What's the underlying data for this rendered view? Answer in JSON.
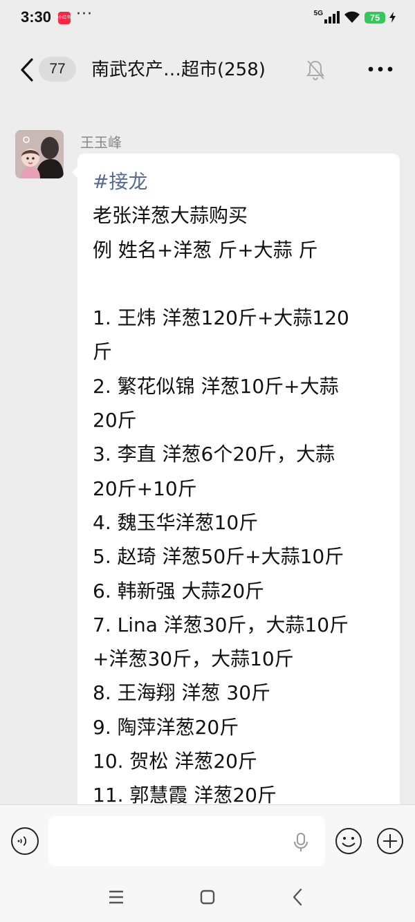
{
  "status_bar": {
    "time": "3:30",
    "app_badge": "小红书",
    "more": "···",
    "network": "5G",
    "battery": "75"
  },
  "header": {
    "unread_count": "77",
    "title": "南武农产…超市(258)"
  },
  "message": {
    "sender": "王玉峰",
    "lines": [
      "#接龙",
      "老张洋葱大蒜购买",
      "例 姓名+洋葱 斤+大蒜 斤",
      "",
      "1. 王炜 洋葱120斤+大蒜120",
      "斤",
      "2. 繁花似锦 洋葱10斤+大蒜",
      "20斤",
      "3. 李直 洋葱6个20斤，大蒜",
      "20斤+10斤",
      "4. 魏玉华洋葱10斤",
      "5. 赵琦 洋葱50斤+大蒜10斤",
      "6. 韩新强  大蒜20斤",
      "7. Lina 洋葱30斤，大蒜10斤",
      "+洋葱30斤，大蒜10斤",
      "8. 王海翔 洋葱 30斤",
      "9. 陶萍洋葱20斤",
      "10. 贺松 洋葱20斤",
      "11. 郭慧霞  洋葱20斤"
    ]
  },
  "colors": {
    "tag": "#576b95",
    "background": "#ededed",
    "bubble": "#ffffff",
    "battery": "#34c759"
  }
}
